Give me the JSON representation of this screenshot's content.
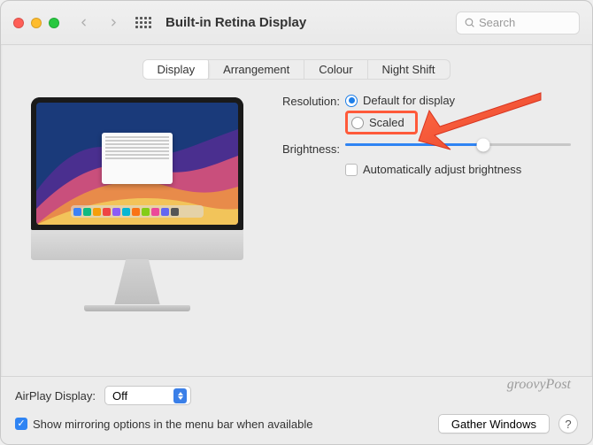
{
  "window": {
    "title": "Built-in Retina Display"
  },
  "search": {
    "placeholder": "Search"
  },
  "tabs": {
    "items": [
      {
        "label": "Display",
        "active": true
      },
      {
        "label": "Arrangement"
      },
      {
        "label": "Colour"
      },
      {
        "label": "Night Shift"
      }
    ]
  },
  "settings": {
    "resolution": {
      "label": "Resolution:",
      "options": {
        "default": {
          "label": "Default for display",
          "selected": true
        },
        "scaled": {
          "label": "Scaled",
          "selected": false
        }
      }
    },
    "brightness": {
      "label": "Brightness:",
      "value_pct": 61,
      "auto_label": "Automatically adjust brightness",
      "auto_checked": false
    }
  },
  "footer": {
    "airplay_label": "AirPlay Display:",
    "airplay_value": "Off",
    "mirroring_label": "Show mirroring options in the menu bar when available",
    "mirroring_checked": true,
    "gather_label": "Gather Windows",
    "help_label": "?"
  },
  "watermark": "groovyPost"
}
